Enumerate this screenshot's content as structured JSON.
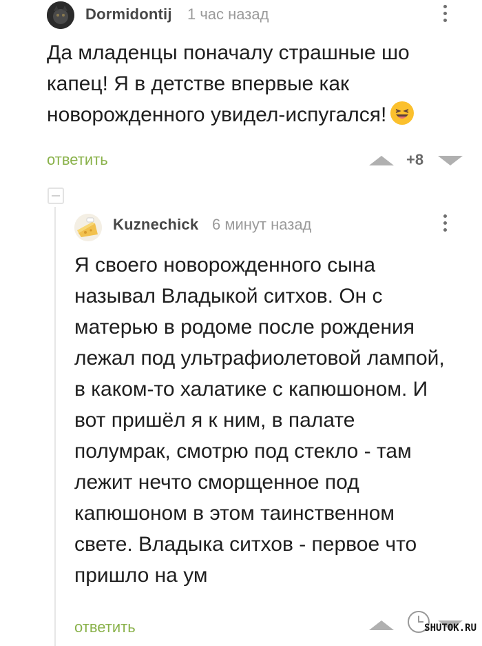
{
  "comments": [
    {
      "author": "Dormidontij",
      "time": "1 час назад",
      "text_lines": [
        "Да младенцы поначалу страшные шо",
        "капец! Я в детстве впервые как",
        "новорожденного увидел-испугался!"
      ],
      "emoji": "laughing-face-emoji",
      "reply_label": "ответить",
      "score": "+8"
    },
    {
      "author": "Kuznechick",
      "time": "6 минут назад",
      "text_lines": [
        "Я своего новорожденного сына",
        "называл Владыкой ситхов. Он с",
        "матерью в родоме после рождения",
        "лежал под ультрафиолетовой лампой,",
        "в каком-то халатике с капюшоном. И",
        "вот пришёл я к ним, в палате",
        "полумрак, смотрю под стекло - там",
        "лежит нечто сморщенное под",
        "капюшоном в этом таинственном",
        "свете. Владыка ситхов - первое что",
        "пришло на ум"
      ],
      "reply_label": "ответить"
    }
  ],
  "watermark": "SHUTOK.RU",
  "colors": {
    "reply": "#8ab24b",
    "arrow": "#b0b0b0",
    "time": "#9a9a9a"
  }
}
